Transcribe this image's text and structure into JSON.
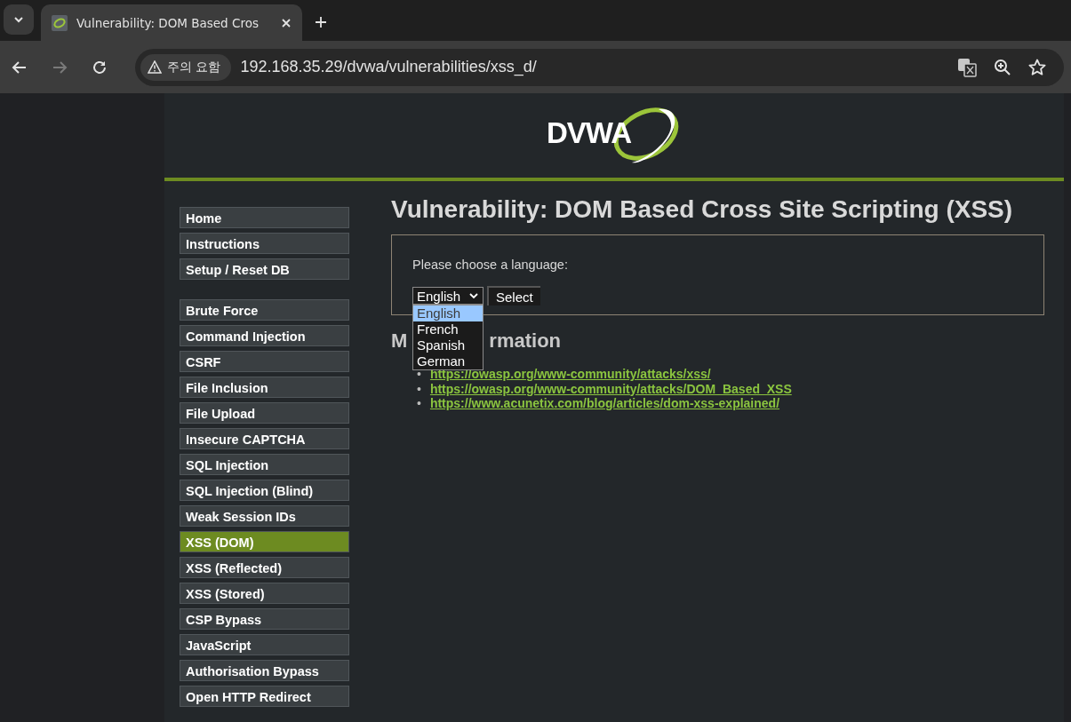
{
  "browser": {
    "tab_title": "Vulnerability: DOM Based Cros",
    "security_label": "주의 요함",
    "url": "192.168.35.29/dvwa/vulnerabilities/xss_d/"
  },
  "logo": {
    "text": "DVWA"
  },
  "menu_groups": [
    [
      {
        "label": "Home",
        "selected": false
      },
      {
        "label": "Instructions",
        "selected": false
      },
      {
        "label": "Setup / Reset DB",
        "selected": false
      }
    ],
    [
      {
        "label": "Brute Force",
        "selected": false
      },
      {
        "label": "Command Injection",
        "selected": false
      },
      {
        "label": "CSRF",
        "selected": false
      },
      {
        "label": "File Inclusion",
        "selected": false
      },
      {
        "label": "File Upload",
        "selected": false
      },
      {
        "label": "Insecure CAPTCHA",
        "selected": false
      },
      {
        "label": "SQL Injection",
        "selected": false
      },
      {
        "label": "SQL Injection (Blind)",
        "selected": false
      },
      {
        "label": "Weak Session IDs",
        "selected": false
      },
      {
        "label": "XSS (DOM)",
        "selected": true
      },
      {
        "label": "XSS (Reflected)",
        "selected": false
      },
      {
        "label": "XSS (Stored)",
        "selected": false
      },
      {
        "label": "CSP Bypass",
        "selected": false
      },
      {
        "label": "JavaScript",
        "selected": false
      },
      {
        "label": "Authorisation Bypass",
        "selected": false
      },
      {
        "label": "Open HTTP Redirect",
        "selected": false
      }
    ]
  ],
  "title": "Vulnerability: DOM Based Cross Site Scripting (XSS)",
  "form": {
    "prompt": "Please choose a language:",
    "select_value": "English",
    "button": "Select",
    "options": [
      {
        "label": "English",
        "selected": true
      },
      {
        "label": "French",
        "selected": false
      },
      {
        "label": "Spanish",
        "selected": false
      },
      {
        "label": "German",
        "selected": false
      }
    ]
  },
  "more_info": {
    "heading_start": "M",
    "heading_end": "rmation",
    "bullet": "•",
    "links": [
      "https://owasp.org/www-community/attacks/xss/",
      "https://owasp.org/www-community/attacks/DOM_Based_XSS",
      "https://www.acunetix.com/blog/articles/dom-xss-explained/"
    ]
  }
}
